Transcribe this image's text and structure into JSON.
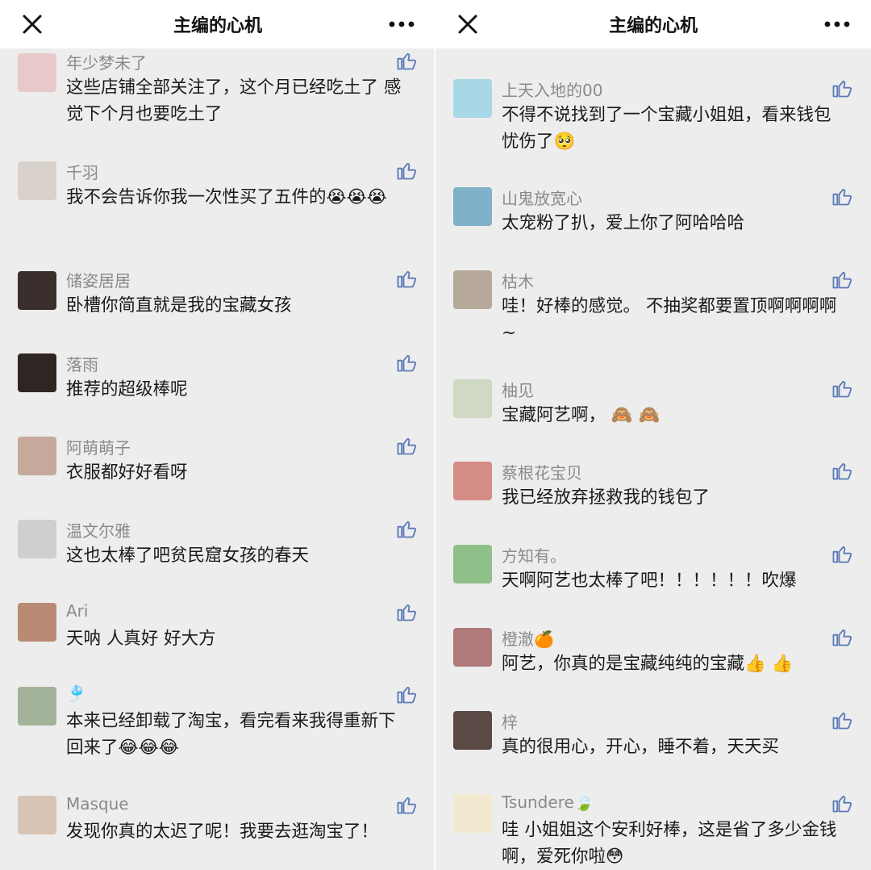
{
  "panels": [
    {
      "header": {
        "title": "主编的心机",
        "close_icon": "close-icon",
        "more_icon": "more-icon"
      },
      "comments": [
        {
          "name": "年少梦未了",
          "text": "这些店铺全部关注了，这个月已经吃土了 感觉下个月也要吃土了",
          "avatar_color": "#e8c9c9"
        },
        {
          "name": "千羽",
          "text": "我不会告诉你我一次性买了五件的😭😭😭",
          "avatar_color": "#d9d2cc"
        },
        {
          "name": "储姿居居",
          "text": "卧槽你简直就是我的宝藏女孩",
          "avatar_color": "#3b2f2d"
        },
        {
          "name": "落雨",
          "text": "推荐的超级棒呢",
          "avatar_color": "#2e2622"
        },
        {
          "name": "阿萌萌子",
          "text": "衣服都好好看呀",
          "avatar_color": "#c6a99b"
        },
        {
          "name": "温文尔雅",
          "text": "这也太棒了吧贫民窟女孩的春天",
          "avatar_color": "#cfcfcf"
        },
        {
          "name": "Ari",
          "text": "天呐 人真好 好大方",
          "avatar_color": "#b98b74"
        },
        {
          "name": "🎐",
          "text": "本来已经卸载了淘宝，看完看来我得重新下回来了😂😂😂",
          "avatar_color": "#a3b39a"
        },
        {
          "name": "Masque",
          "text": "发现你真的太迟了呢！我要去逛淘宝了！",
          "avatar_color": "#d7c4b5"
        }
      ]
    },
    {
      "header": {
        "title": "主编的心机",
        "close_icon": "close-icon",
        "more_icon": "more-icon"
      },
      "comments": [
        {
          "name": "上天入地的00",
          "text": "不得不说找到了一个宝藏小姐姐，看来钱包忧伤了🥺",
          "avatar_color": "#a8d8e6"
        },
        {
          "name": "山鬼放宽心",
          "text": "太宠粉了扒，爱上你了阿哈哈哈",
          "avatar_color": "#7fb2c8"
        },
        {
          "name": "枯木",
          "text": "哇！好棒的感觉。 不抽奖都要置顶啊啊啊啊~",
          "avatar_color": "#b7a99a"
        },
        {
          "name": "柚见",
          "text": "宝藏阿艺啊， 🙈 🙈",
          "avatar_color": "#cfd9c4"
        },
        {
          "name": "蔡根花宝贝",
          "text": "我已经放弃拯救我的钱包了",
          "avatar_color": "#d58b86"
        },
        {
          "name": "方知有。",
          "text": "天啊阿艺也太棒了吧！！！！！！吹爆",
          "avatar_color": "#8fc08a"
        },
        {
          "name": "橙澈🍊",
          "text": "阿艺，你真的是宝藏纯纯的宝藏👍 👍",
          "avatar_color": "#b07a7a"
        },
        {
          "name": "梓",
          "text": "真的很用心，开心，睡不着，天天买",
          "avatar_color": "#5b4a45"
        },
        {
          "name": "Tsundere🍃",
          "text": "哇 小姐姐这个安利好棒，这是省了多少金钱啊，爱死你啦😳",
          "avatar_color": "#f2e9d0"
        }
      ]
    }
  ]
}
